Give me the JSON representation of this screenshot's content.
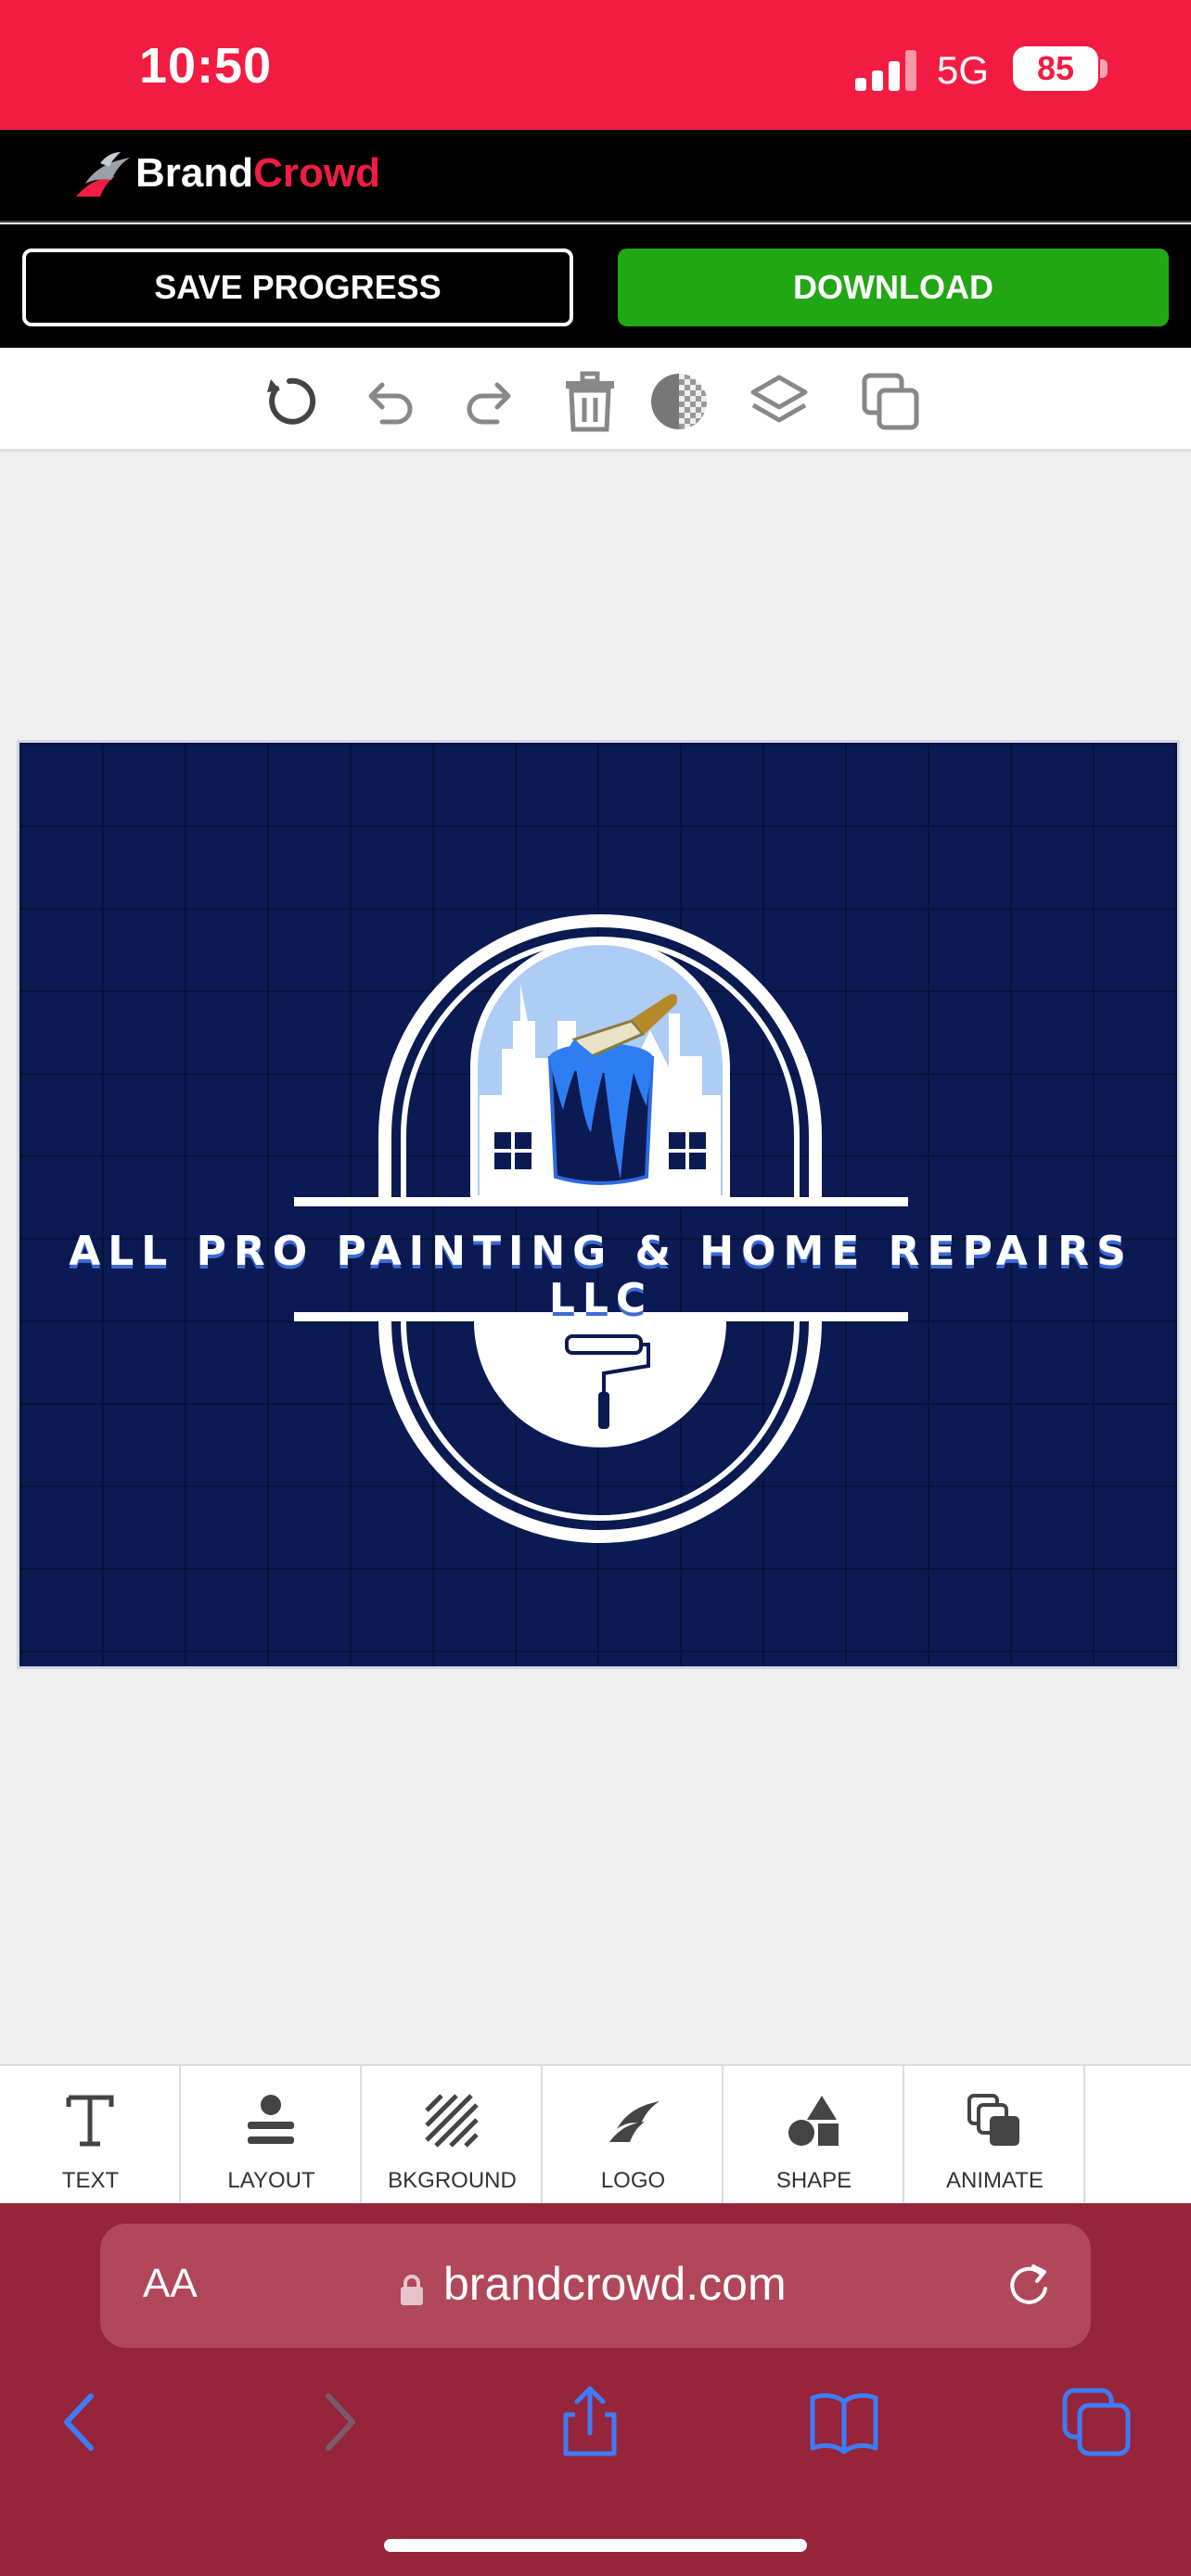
{
  "status_bar": {
    "time": "10:50",
    "network": "5G",
    "battery": "85"
  },
  "brand": {
    "name_part1": "Brand",
    "name_part2": "Crowd"
  },
  "actions": {
    "save_label": "SAVE PROGRESS",
    "download_label": "DOWNLOAD"
  },
  "toolbar": {
    "icons": [
      "reset-icon",
      "undo-icon",
      "redo-icon",
      "trash-icon",
      "transparency-icon",
      "layers-icon",
      "duplicate-icon"
    ]
  },
  "canvas": {
    "logo_text": "ALL PRO PAINTING & HOME REPAIRS LLC",
    "background_color": "#0b1a52",
    "accent_color": "#3b6ad8"
  },
  "tabs": [
    {
      "label": "TEXT",
      "icon": "text-icon"
    },
    {
      "label": "LAYOUT",
      "icon": "layout-icon"
    },
    {
      "label": "BKGROUND",
      "icon": "background-icon"
    },
    {
      "label": "LOGO",
      "icon": "logo-icon"
    },
    {
      "label": "SHAPE",
      "icon": "shape-icon"
    },
    {
      "label": "ANIMATE",
      "icon": "animate-icon"
    }
  ],
  "browser": {
    "aa_label": "AA",
    "url": "brandcrowd.com"
  },
  "colors": {
    "status": "#f21c42",
    "download": "#22a714",
    "safari": "#96243a"
  }
}
